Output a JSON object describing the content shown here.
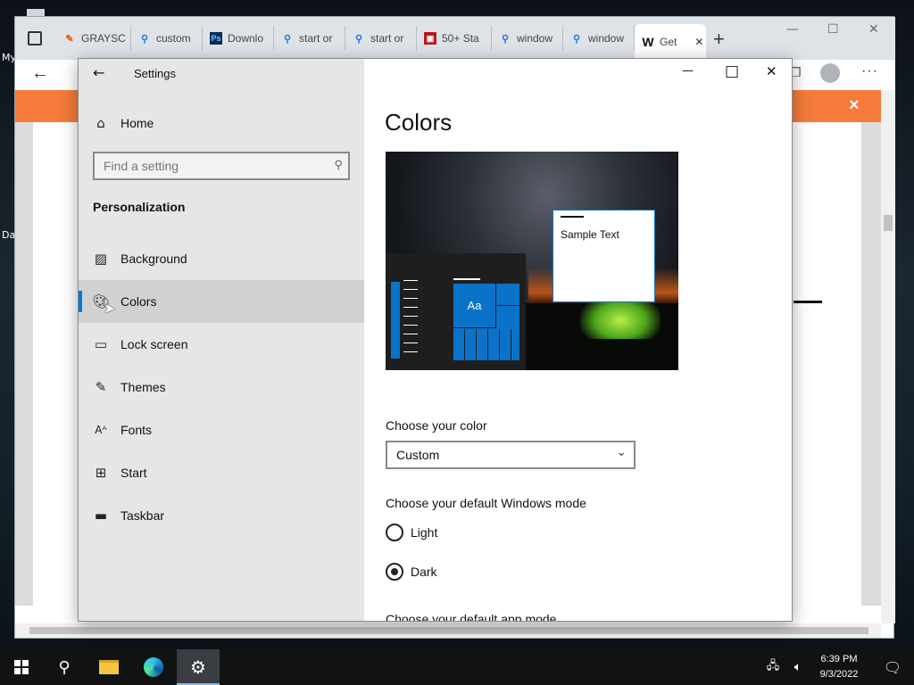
{
  "desktop": {
    "left_label": "My",
    "left_label2": "Da"
  },
  "browser": {
    "tabs": [
      {
        "label": "GRAYSC",
        "icon": "feather-icon"
      },
      {
        "label": "custom",
        "icon": "search-icon"
      },
      {
        "label": "Downlo",
        "icon": "ps-icon"
      },
      {
        "label": "start or",
        "icon": "search-icon"
      },
      {
        "label": "start or",
        "icon": "search-icon"
      },
      {
        "label": "50+ Sta",
        "icon": "site-icon"
      },
      {
        "label": "window",
        "icon": "search-icon"
      },
      {
        "label": "window",
        "icon": "search-icon"
      },
      {
        "label": "Get",
        "icon": "wikihow-icon"
      }
    ],
    "active_tab_favicon": "W",
    "orange_close": "×"
  },
  "settings": {
    "title": "Settings",
    "back": "←",
    "home_label": "Home",
    "search_placeholder": "Find a setting",
    "section": "Personalization",
    "nav": [
      {
        "label": "Background",
        "icon": "picture-icon"
      },
      {
        "label": "Colors",
        "icon": "palette-icon",
        "selected": true
      },
      {
        "label": "Lock screen",
        "icon": "lock-screen-icon"
      },
      {
        "label": "Themes",
        "icon": "themes-icon"
      },
      {
        "label": "Fonts",
        "icon": "fonts-icon"
      },
      {
        "label": "Start",
        "icon": "start-icon"
      },
      {
        "label": "Taskbar",
        "icon": "taskbar-icon"
      }
    ],
    "main": {
      "heading": "Colors",
      "preview_sample_text": "Sample Text",
      "preview_tile_text": "Aa",
      "choose_color_label": "Choose your color",
      "choose_color_value": "Custom",
      "windows_mode_label": "Choose your default Windows mode",
      "mode_options": [
        {
          "label": "Light",
          "checked": false
        },
        {
          "label": "Dark",
          "checked": true
        }
      ],
      "app_mode_label": "Choose your default app mode"
    },
    "window_controls": {
      "minimize": "—",
      "maximize": "□",
      "close": "✕"
    }
  },
  "taskbar": {
    "time": "6:39 PM",
    "date": "9/3/2022"
  },
  "colors": {
    "accent": "#0078d7",
    "orange_banner": "#f47b3a"
  }
}
